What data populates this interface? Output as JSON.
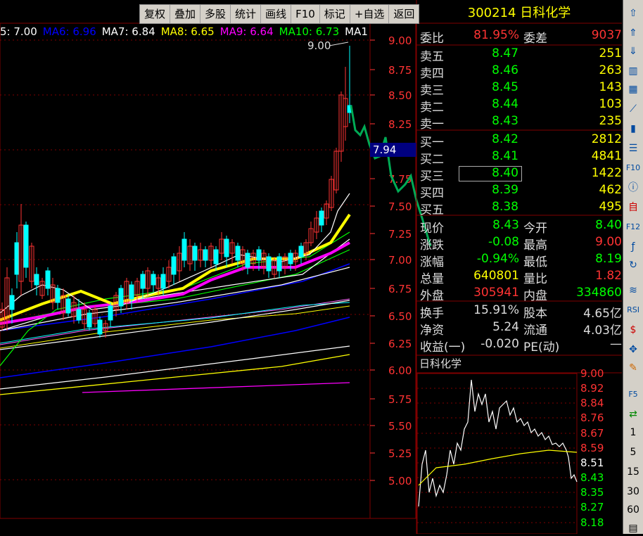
{
  "toolbar": {
    "items": [
      "复权",
      "叠加",
      "多股",
      "统计",
      "画线",
      "F10",
      "标记",
      "+自选",
      "返回"
    ]
  },
  "stock": {
    "code": "300214",
    "name": "日科化学",
    "title": "300214 日科化学"
  },
  "ma_legend": [
    {
      "label": "5: 7.00",
      "color": "#ffffff"
    },
    {
      "label": "MA6: 6.96",
      "color": "#0000ff"
    },
    {
      "label": "MA7: 6.84",
      "color": "#ffffff"
    },
    {
      "label": "MA8: 6.65",
      "color": "#ffff00"
    },
    {
      "label": "MA9: 6.64",
      "color": "#ff00ff"
    },
    {
      "label": "MA10: 6.73",
      "color": "#00ff00"
    },
    {
      "label": "MA1",
      "color": "#ffffff"
    }
  ],
  "main_axis": [
    "9.00",
    "8.75",
    "8.50",
    "8.25",
    "7.75",
    "7.50",
    "7.25",
    "7.00",
    "6.75",
    "6.50",
    "6.25",
    "6.00",
    "5.75",
    "5.50",
    "5.25",
    "5.00"
  ],
  "high_marker": "9.00",
  "cursor_price": "7.94",
  "order_book": {
    "weibi_label": "委比",
    "weibi_value": "81.95%",
    "weicha_label": "委差",
    "weicha_value": "9037",
    "asks": [
      {
        "label": "卖五",
        "price": "8.47",
        "vol": "251"
      },
      {
        "label": "卖四",
        "price": "8.46",
        "vol": "263"
      },
      {
        "label": "卖三",
        "price": "8.45",
        "vol": "143"
      },
      {
        "label": "卖二",
        "price": "8.44",
        "vol": "103"
      },
      {
        "label": "卖一",
        "price": "8.43",
        "vol": "235"
      }
    ],
    "bids": [
      {
        "label": "买一",
        "price": "8.42",
        "vol": "2812"
      },
      {
        "label": "买二",
        "price": "8.41",
        "vol": "4841"
      },
      {
        "label": "买三",
        "price": "8.40",
        "vol": "1422"
      },
      {
        "label": "买四",
        "price": "8.39",
        "vol": "462"
      },
      {
        "label": "买五",
        "price": "8.38",
        "vol": "495"
      }
    ]
  },
  "stats": [
    {
      "l1": "现价",
      "v1": "8.43",
      "c1": "#00ff00",
      "l2": "今开",
      "v2": "8.40",
      "c2": "#00ff00"
    },
    {
      "l1": "涨跌",
      "v1": "-0.08",
      "c1": "#00ff00",
      "l2": "最高",
      "v2": "9.00",
      "c2": "#ff3333"
    },
    {
      "l1": "涨幅",
      "v1": "-0.94%",
      "c1": "#00ff00",
      "l2": "最低",
      "v2": "8.19",
      "c2": "#00ff00"
    },
    {
      "l1": "总量",
      "v1": "640801",
      "c1": "#ffff00",
      "l2": "量比",
      "v2": "1.82",
      "c2": "#ff3333"
    },
    {
      "l1": "外盘",
      "v1": "305941",
      "c1": "#ff3333",
      "l2": "内盘",
      "v2": "334860",
      "c2": "#00ff00"
    }
  ],
  "fund": [
    {
      "l1": "换手",
      "v1": "15.91%",
      "l2": "股本",
      "v2": "4.65亿"
    },
    {
      "l1": "净资",
      "v1": "5.24",
      "l2": "流通",
      "v2": "4.03亿"
    },
    {
      "l1": "收益(一)",
      "v1": "-0.020",
      "l2": "PE(动)",
      "v2": "—"
    }
  ],
  "mini": {
    "title": "日科化学",
    "axis": [
      "9.00",
      "8.92",
      "8.84",
      "8.76",
      "8.67",
      "8.59",
      "8.51",
      "8.43",
      "8.35",
      "8.27",
      "8.18"
    ]
  },
  "side_numbers": [
    "1",
    "5",
    "15",
    "30",
    "60"
  ],
  "colors": {
    "up": "#ff3333",
    "down": "#00ffff",
    "axis": "#ff3333",
    "grid": "#800000"
  }
}
